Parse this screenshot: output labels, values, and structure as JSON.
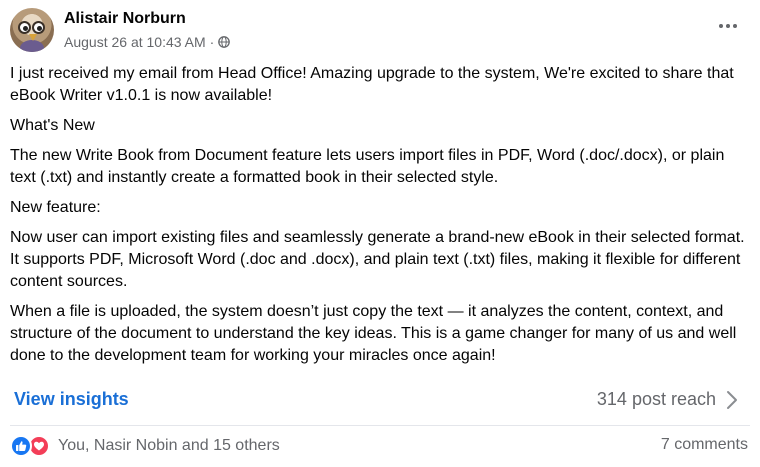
{
  "post": {
    "author": "Alistair Norburn",
    "timestamp": "August 26 at 10:43 AM",
    "separator": "·",
    "privacy_icon": "globe-icon",
    "more_icon": "more-options-icon",
    "paragraphs": [
      "I just received my email from Head Office! Amazing upgrade to the system, We're excited to share that eBook Writer v1.0.1 is now available!",
      "What's New",
      "The new Write Book from Document feature lets users import files in PDF, Word (.doc/.docx), or plain text (.txt) and instantly create a formatted book in their selected style.",
      "New feature:",
      "Now user can import existing files and seamlessly generate a brand-new eBook in their selected format. It supports PDF, Microsoft Word (.doc and .docx), and plain text (.txt) files, making it flexible for different content sources.",
      "When a file is uploaded, the system doesn’t just copy the text — it analyzes the content, context, and structure of the document to understand the key ideas. This is a game changer for many of us and well done to the development team for working your miracles once again!"
    ]
  },
  "insights": {
    "link_label": "View insights",
    "reach_label": "314 post reach",
    "link_color": "#1a6fd6"
  },
  "engagement": {
    "reactions_text": "You, Nasir Nobin and 15 others",
    "comments_text": "7 comments",
    "like_color": "#1877f2",
    "love_color": "#f33e58"
  }
}
